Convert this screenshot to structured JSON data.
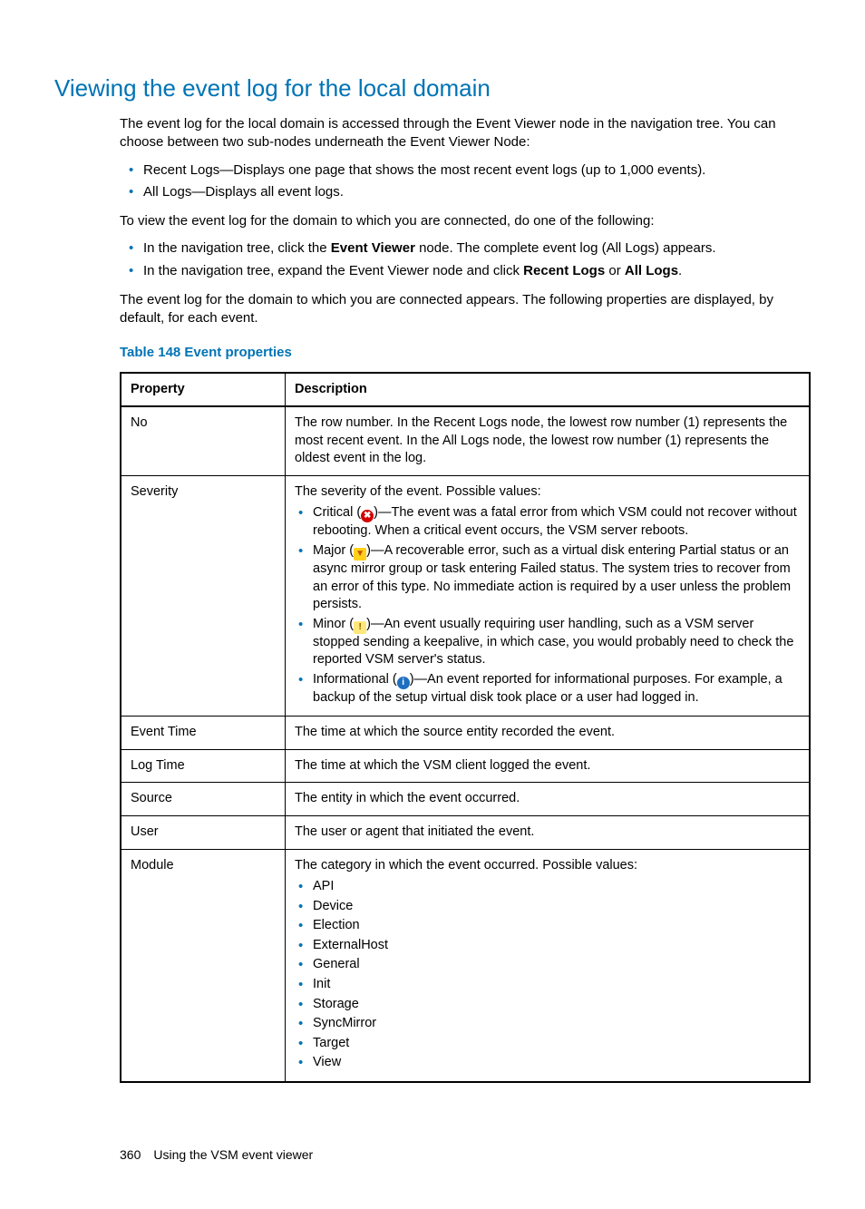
{
  "heading": "Viewing the event log for the local domain",
  "intro": "The event log for the local domain is accessed through the Event Viewer node in the navigation tree. You can choose between two sub-nodes underneath the Event Viewer Node:",
  "subnodes": [
    "Recent Logs—Displays one page that shows the most recent event logs (up to 1,000 events).",
    "All Logs—Displays all event logs."
  ],
  "howto_lead": "To view the event log for the domain to which you are connected, do one of the following:",
  "howto_items": {
    "a_pre": "In the navigation tree, click the ",
    "a_bold": "Event Viewer",
    "a_post": " node. The complete event log (All Logs) appears.",
    "b_pre": "In the navigation tree, expand the Event Viewer node and click ",
    "b_bold1": "Recent Logs",
    "b_mid": " or ",
    "b_bold2": "All Logs",
    "b_post": "."
  },
  "after_list": "The event log for the domain to which you are connected appears. The following properties are displayed, by default, for each event.",
  "table_caption": "Table 148 Event properties",
  "th_property": "Property",
  "th_description": "Description",
  "rows": {
    "no": {
      "prop": "No",
      "desc": "The row number. In the Recent Logs node, the lowest row number (1) represents the most recent event. In the All Logs node, the lowest row number (1) represents the oldest event in the log."
    },
    "severity": {
      "prop": "Severity",
      "lead": "The severity of the event. Possible values:",
      "critical": ")—The event was a fatal error from which VSM could not recover without rebooting. When a critical event occurs, the VSM server reboots.",
      "critical_lbl": "Critical (",
      "major": ")—A recoverable error, such as a virtual disk entering Partial status or an async mirror group or task entering Failed status. The system tries to recover from an error of this type. No immediate action is required by a user unless the problem persists.",
      "major_lbl": "Major (",
      "minor": ")—An event usually requiring user handling, such as a VSM server stopped sending a keepalive, in which case, you would probably need to check the reported VSM server's status.",
      "minor_lbl": "Minor (",
      "info": ")—An event reported for informational purposes. For example, a backup of the setup virtual disk took place or a user had logged in.",
      "info_lbl": "Informational ("
    },
    "event_time": {
      "prop": "Event Time",
      "desc": "The time at which the source entity recorded the event."
    },
    "log_time": {
      "prop": "Log Time",
      "desc": "The time at which the VSM client logged the event."
    },
    "source": {
      "prop": "Source",
      "desc": "The entity in which the event occurred."
    },
    "user": {
      "prop": "User",
      "desc": "The user or agent that initiated the event."
    },
    "module": {
      "prop": "Module",
      "lead": "The category in which the event occurred. Possible values:",
      "items": [
        "API",
        "Device",
        "Election",
        "ExternalHost",
        "General",
        "Init",
        "Storage",
        "SyncMirror",
        "Target",
        "View"
      ]
    }
  },
  "footer_page": "360",
  "footer_text": "Using the VSM event viewer"
}
